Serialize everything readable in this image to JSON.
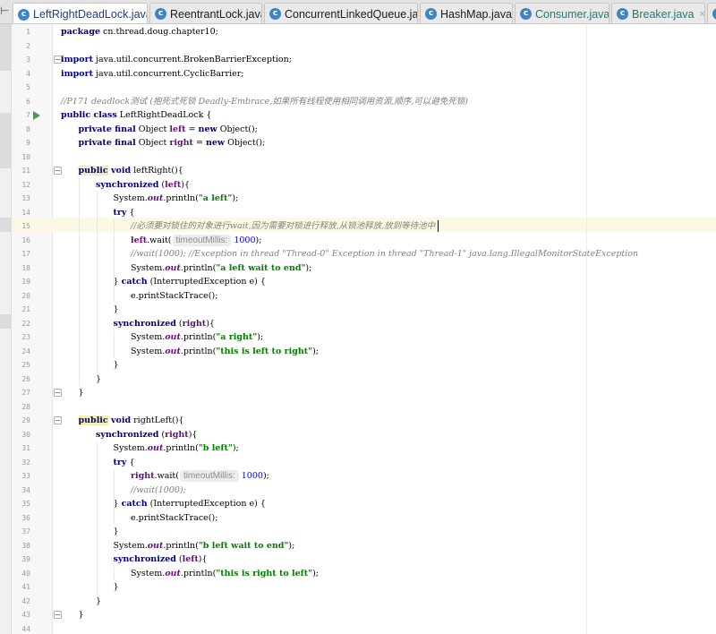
{
  "tabs": [
    {
      "label": "LeftRightDeadLock.java",
      "active": true,
      "label_color": "#1f3b8a"
    },
    {
      "label": "ReentrantLock.java",
      "active": false,
      "label_color": "#1a1a1a"
    },
    {
      "label": "ConcurrentLinkedQueue.java",
      "active": false,
      "label_color": "#1a1a1a"
    },
    {
      "label": "HashMap.java",
      "active": false,
      "label_color": "#1a1a1a"
    },
    {
      "label": "Consumer.java",
      "active": false,
      "label_color": "#1f7a7a"
    },
    {
      "label": "Breaker.java",
      "active": false,
      "label_color": "#1f7a7a"
    }
  ],
  "tab_icon_letter": "c",
  "tab_icon_color": "#3d86c6",
  "tab_close_glyph": "×",
  "tab_overflow_glyph": "⊢",
  "run_icon": "run-icon",
  "colors": {
    "keyword": "#000080",
    "field": "#660e7a",
    "string": "#008000",
    "number": "#0000ff",
    "comment": "#808080",
    "caret_row": "#fdf8e4",
    "method_highlight": "#f3eeb6"
  },
  "lines": [
    {
      "n": "1",
      "indent": 0,
      "tokens": [
        {
          "t": "kw",
          "v": "package"
        },
        {
          "t": "p",
          "v": " cn.thread.doug.chapter10;"
        }
      ]
    },
    {
      "n": "2",
      "indent": 0,
      "tokens": []
    },
    {
      "n": "3",
      "indent": 0,
      "tokens": [
        {
          "t": "kw",
          "v": "import"
        },
        {
          "t": "p",
          "v": " java.util.concurrent.BrokenBarrierException;"
        }
      ]
    },
    {
      "n": "4",
      "indent": 0,
      "tokens": [
        {
          "t": "kw",
          "v": "import"
        },
        {
          "t": "p",
          "v": " java.util.concurrent.CyclicBarrier;"
        }
      ]
    },
    {
      "n": "5",
      "indent": 0,
      "tokens": []
    },
    {
      "n": "6",
      "indent": 0,
      "tokens": [
        {
          "t": "cmt",
          "v": "//P171 deadlock测试 (抱死式死锁 Deadly-Embrace,如果所有线程使用相同调用资源,顺序,可以避免死锁)"
        }
      ]
    },
    {
      "n": "7",
      "indent": 0,
      "tokens": [
        {
          "t": "kw",
          "v": "public class"
        },
        {
          "t": "p",
          "v": " LeftRightDeadLock {"
        }
      ]
    },
    {
      "n": "8",
      "indent": 1,
      "tokens": [
        {
          "t": "kw",
          "v": "private final"
        },
        {
          "t": "p",
          "v": " Object "
        },
        {
          "t": "fld",
          "v": "left"
        },
        {
          "t": "p",
          "v": " = "
        },
        {
          "t": "kw",
          "v": "new"
        },
        {
          "t": "p",
          "v": " Object();"
        }
      ]
    },
    {
      "n": "9",
      "indent": 1,
      "tokens": [
        {
          "t": "kw",
          "v": "private final"
        },
        {
          "t": "p",
          "v": " Object "
        },
        {
          "t": "fld",
          "v": "right"
        },
        {
          "t": "p",
          "v": " = "
        },
        {
          "t": "kw",
          "v": "new"
        },
        {
          "t": "p",
          "v": " Object();"
        }
      ]
    },
    {
      "n": "10",
      "indent": 0,
      "tokens": []
    },
    {
      "n": "11",
      "indent": 1,
      "tokens": [
        {
          "t": "kwh",
          "v": "public"
        },
        {
          "t": "kw",
          "v": " void"
        },
        {
          "t": "p",
          "v": " leftRight(){"
        }
      ]
    },
    {
      "n": "12",
      "indent": 2,
      "tokens": [
        {
          "t": "kw",
          "v": "synchronized"
        },
        {
          "t": "p",
          "v": " ("
        },
        {
          "t": "fld",
          "v": "left"
        },
        {
          "t": "p",
          "v": "){"
        }
      ]
    },
    {
      "n": "13",
      "indent": 3,
      "tokens": [
        {
          "t": "p",
          "v": "System."
        },
        {
          "t": "sfld",
          "v": "out"
        },
        {
          "t": "p",
          "v": ".println("
        },
        {
          "t": "str",
          "v": "\"a left\""
        },
        {
          "t": "p",
          "v": ");"
        }
      ]
    },
    {
      "n": "14",
      "indent": 3,
      "tokens": [
        {
          "t": "kw",
          "v": "try"
        },
        {
          "t": "p",
          "v": " {"
        }
      ]
    },
    {
      "n": "15",
      "indent": 4,
      "tokens": [
        {
          "t": "cmt",
          "v": "//必须要对锁住的对象进行wait,因为需要对锁进行释放,从锁池释放,放到等待池中"
        },
        {
          "t": "cursor",
          "v": ""
        }
      ]
    },
    {
      "n": "16",
      "indent": 4,
      "tokens": [
        {
          "t": "fld",
          "v": "left"
        },
        {
          "t": "p",
          "v": ".wait("
        },
        {
          "t": "hint",
          "v": "timeoutMillis:"
        },
        {
          "t": "num",
          "v": "1000"
        },
        {
          "t": "p",
          "v": ");"
        }
      ]
    },
    {
      "n": "17",
      "indent": 4,
      "tokens": [
        {
          "t": "cmt",
          "v": "//wait(1000); //Exception in thread \"Thread-0\" Exception in thread \"Thread-1\" java.lang.IllegalMonitorStateException"
        }
      ]
    },
    {
      "n": "18",
      "indent": 4,
      "tokens": [
        {
          "t": "p",
          "v": "System."
        },
        {
          "t": "sfld",
          "v": "out"
        },
        {
          "t": "p",
          "v": ".println("
        },
        {
          "t": "str",
          "v": "\"a left wait to end\""
        },
        {
          "t": "p",
          "v": ");"
        }
      ]
    },
    {
      "n": "19",
      "indent": 3,
      "tokens": [
        {
          "t": "p",
          "v": "} "
        },
        {
          "t": "kw",
          "v": "catch"
        },
        {
          "t": "p",
          "v": " (InterruptedException e) {"
        }
      ]
    },
    {
      "n": "20",
      "indent": 4,
      "tokens": [
        {
          "t": "p",
          "v": "e.printStackTrace();"
        }
      ]
    },
    {
      "n": "21",
      "indent": 3,
      "tokens": [
        {
          "t": "p",
          "v": "}"
        }
      ]
    },
    {
      "n": "22",
      "indent": 3,
      "tokens": [
        {
          "t": "kw",
          "v": "synchronized"
        },
        {
          "t": "p",
          "v": " ("
        },
        {
          "t": "fld",
          "v": "right"
        },
        {
          "t": "p",
          "v": "){"
        }
      ]
    },
    {
      "n": "23",
      "indent": 4,
      "tokens": [
        {
          "t": "p",
          "v": "System."
        },
        {
          "t": "sfld",
          "v": "out"
        },
        {
          "t": "p",
          "v": ".println("
        },
        {
          "t": "str",
          "v": "\"a right\""
        },
        {
          "t": "p",
          "v": ");"
        }
      ]
    },
    {
      "n": "24",
      "indent": 4,
      "tokens": [
        {
          "t": "p",
          "v": "System."
        },
        {
          "t": "sfld",
          "v": "out"
        },
        {
          "t": "p",
          "v": ".println("
        },
        {
          "t": "str",
          "v": "\"this is left to right\""
        },
        {
          "t": "p",
          "v": ");"
        }
      ]
    },
    {
      "n": "25",
      "indent": 3,
      "tokens": [
        {
          "t": "p",
          "v": "}"
        }
      ]
    },
    {
      "n": "26",
      "indent": 2,
      "tokens": [
        {
          "t": "p",
          "v": "}"
        }
      ]
    },
    {
      "n": "27",
      "indent": 1,
      "tokens": [
        {
          "t": "p",
          "v": "}"
        }
      ]
    },
    {
      "n": "28",
      "indent": 0,
      "tokens": []
    },
    {
      "n": "29",
      "indent": 1,
      "tokens": [
        {
          "t": "kwh",
          "v": "public"
        },
        {
          "t": "kw",
          "v": " void"
        },
        {
          "t": "p",
          "v": " rightLeft(){"
        }
      ]
    },
    {
      "n": "30",
      "indent": 2,
      "tokens": [
        {
          "t": "kw",
          "v": "synchronized"
        },
        {
          "t": "p",
          "v": " ("
        },
        {
          "t": "fld",
          "v": "right"
        },
        {
          "t": "p",
          "v": "){"
        }
      ]
    },
    {
      "n": "31",
      "indent": 3,
      "tokens": [
        {
          "t": "p",
          "v": "System."
        },
        {
          "t": "sfld",
          "v": "out"
        },
        {
          "t": "p",
          "v": ".println("
        },
        {
          "t": "str",
          "v": "\"b left\""
        },
        {
          "t": "p",
          "v": ");"
        }
      ]
    },
    {
      "n": "32",
      "indent": 3,
      "tokens": [
        {
          "t": "kw",
          "v": "try"
        },
        {
          "t": "p",
          "v": " {"
        }
      ]
    },
    {
      "n": "33",
      "indent": 4,
      "tokens": [
        {
          "t": "fld",
          "v": "right"
        },
        {
          "t": "p",
          "v": ".wait("
        },
        {
          "t": "hint",
          "v": "timeoutMillis:"
        },
        {
          "t": "num",
          "v": "1000"
        },
        {
          "t": "p",
          "v": ");"
        }
      ]
    },
    {
      "n": "34",
      "indent": 4,
      "tokens": [
        {
          "t": "cmt",
          "v": "//wait(1000);"
        }
      ]
    },
    {
      "n": "35",
      "indent": 3,
      "tokens": [
        {
          "t": "p",
          "v": "} "
        },
        {
          "t": "kw",
          "v": "catch"
        },
        {
          "t": "p",
          "v": " (InterruptedException e) {"
        }
      ]
    },
    {
      "n": "36",
      "indent": 4,
      "tokens": [
        {
          "t": "p",
          "v": "e.printStackTrace();"
        }
      ]
    },
    {
      "n": "37",
      "indent": 3,
      "tokens": [
        {
          "t": "p",
          "v": "}"
        }
      ]
    },
    {
      "n": "38",
      "indent": 3,
      "tokens": [
        {
          "t": "p",
          "v": "System."
        },
        {
          "t": "sfld",
          "v": "out"
        },
        {
          "t": "p",
          "v": ".println("
        },
        {
          "t": "str",
          "v": "\"b left wait to end\""
        },
        {
          "t": "p",
          "v": ");"
        }
      ]
    },
    {
      "n": "39",
      "indent": 3,
      "tokens": [
        {
          "t": "kw",
          "v": "synchronized"
        },
        {
          "t": "p",
          "v": " ("
        },
        {
          "t": "fld",
          "v": "left"
        },
        {
          "t": "p",
          "v": "){"
        }
      ]
    },
    {
      "n": "40",
      "indent": 4,
      "tokens": [
        {
          "t": "p",
          "v": "System."
        },
        {
          "t": "sfld",
          "v": "out"
        },
        {
          "t": "p",
          "v": ".println("
        },
        {
          "t": "str",
          "v": "\"this is right to left\""
        },
        {
          "t": "p",
          "v": ");"
        }
      ]
    },
    {
      "n": "41",
      "indent": 3,
      "tokens": [
        {
          "t": "p",
          "v": "}"
        }
      ]
    },
    {
      "n": "42",
      "indent": 2,
      "tokens": [
        {
          "t": "p",
          "v": "}"
        }
      ]
    },
    {
      "n": "43",
      "indent": 1,
      "tokens": [
        {
          "t": "p",
          "v": "}"
        }
      ]
    },
    {
      "n": "44",
      "indent": 0,
      "tokens": []
    }
  ]
}
